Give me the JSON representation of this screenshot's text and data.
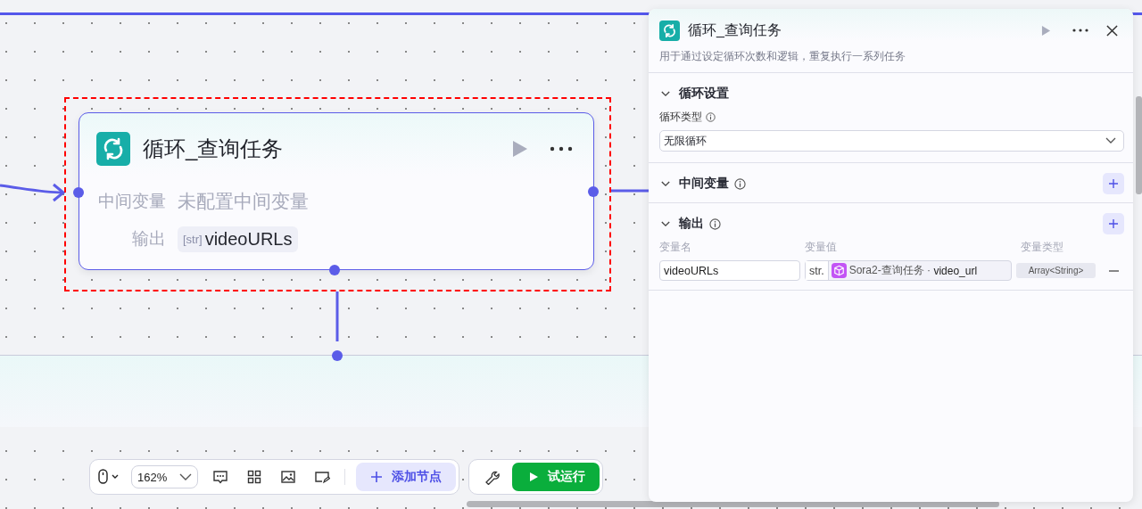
{
  "node": {
    "title": "循环_查询任务",
    "rows": [
      {
        "kind": "text",
        "label": "中间变量",
        "value": "未配置中间变量"
      },
      {
        "kind": "tag",
        "label": "输出",
        "type_tag": "[str]",
        "value": "videoURLs"
      }
    ]
  },
  "panel": {
    "title": "循环_查询任务",
    "description": "用于通过设定循环次数和逻辑，重复执行一系列任务",
    "sections": [
      {
        "kind": "select",
        "title": "循环设置",
        "expanded": true,
        "info": false,
        "add": false,
        "field_label": "循环类型",
        "value": "无限循环"
      },
      {
        "kind": "empty",
        "title": "中间变量",
        "expanded": true,
        "info": true,
        "add": true
      },
      {
        "kind": "table",
        "title": "输出",
        "expanded": true,
        "info": true,
        "add": true,
        "columns": [
          "变量名",
          "变量值",
          "变量类型"
        ],
        "rows": [
          {
            "name": "videoURLs",
            "prefix": "str.",
            "source": "Sora2-查询任务 ·",
            "field": "video_url",
            "type": "Array<String>"
          }
        ]
      }
    ]
  },
  "toolbar": {
    "zoom": "162%",
    "add_node": "添加节点",
    "run": "试运行"
  }
}
